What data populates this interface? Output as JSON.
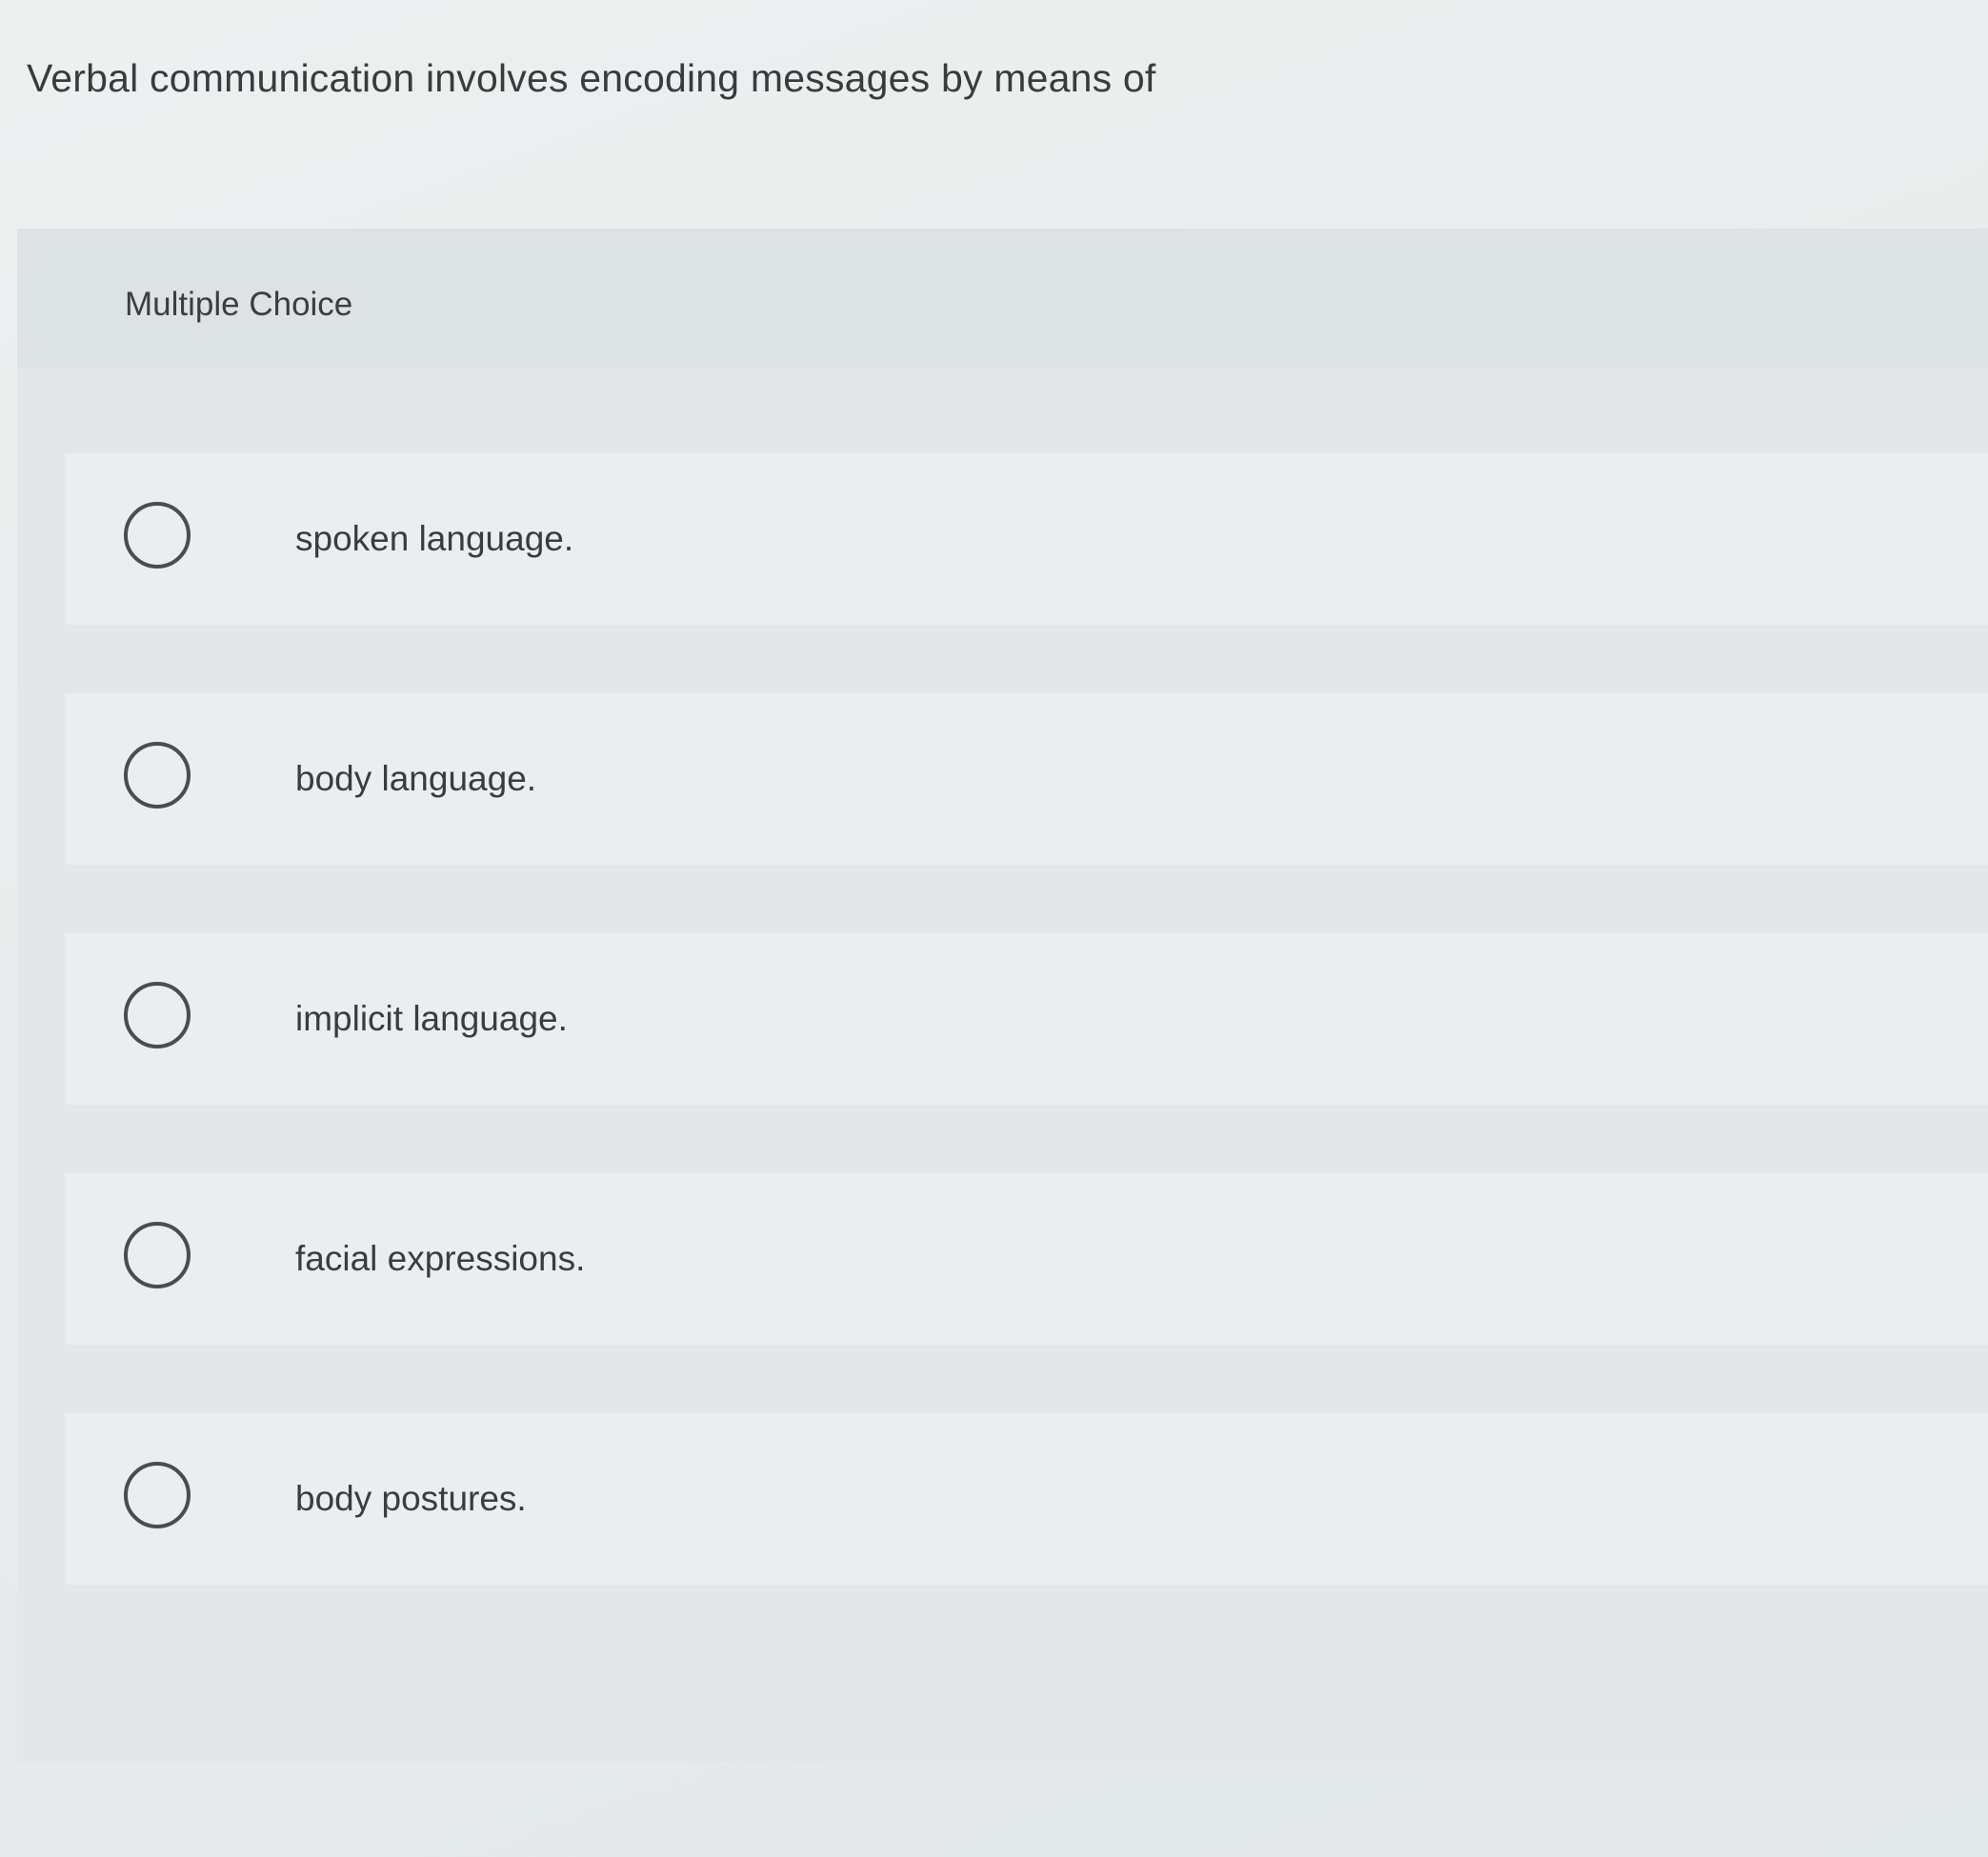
{
  "question": {
    "text": "Verbal communication involves encoding messages by means of"
  },
  "question_type": {
    "label": "Multiple Choice"
  },
  "options": [
    {
      "label": "spoken language.",
      "selected": false
    },
    {
      "label": "body language.",
      "selected": false
    },
    {
      "label": "implicit language.",
      "selected": false
    },
    {
      "label": "facial expressions.",
      "selected": false
    },
    {
      "label": "body postures.",
      "selected": false
    }
  ],
  "colors": {
    "background": "#e9ecec",
    "panel": "#e3e7e9",
    "option_row": "#eaeeef",
    "text": "#3c3d3f",
    "radio_border": "#4a4c4f"
  },
  "icons": {
    "radio": "radio-button-unselected-icon"
  }
}
